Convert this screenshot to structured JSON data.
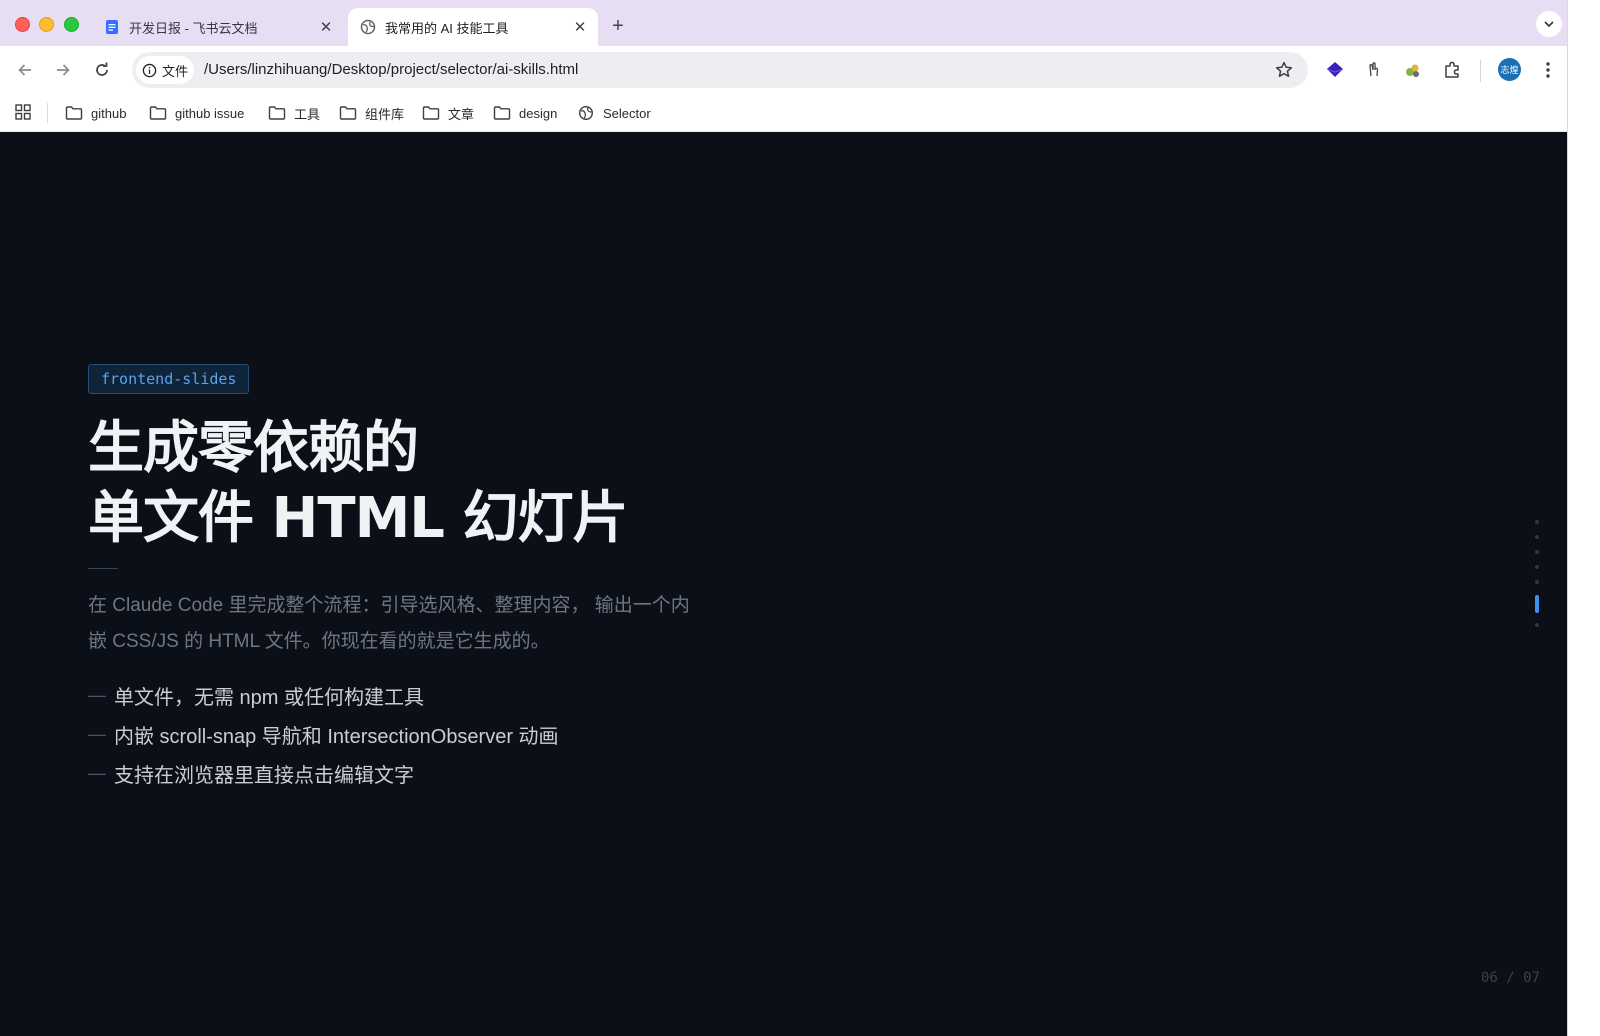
{
  "browser": {
    "tabs": [
      {
        "title": "开发日报 - 飞书云文档",
        "active": false,
        "favicon": "doc-icon"
      },
      {
        "title": "我常用的 AI 技能工具",
        "active": true,
        "favicon": "globe-icon"
      }
    ],
    "address": {
      "site_label": "文件",
      "url": "/Users/linzhihuang/Desktop/project/selector/ai-skills.html"
    },
    "avatar_text": "志煌",
    "bookmarks": [
      {
        "label": "github",
        "icon": "folder-icon"
      },
      {
        "label": "github issue",
        "icon": "folder-icon"
      },
      {
        "label": "工具",
        "icon": "folder-icon"
      },
      {
        "label": "组件库",
        "icon": "folder-icon"
      },
      {
        "label": "文章",
        "icon": "folder-icon"
      },
      {
        "label": "design",
        "icon": "folder-icon"
      },
      {
        "label": "Selector",
        "icon": "globe-icon"
      }
    ]
  },
  "slide": {
    "tag": "frontend-slides",
    "headline_line1": "生成零依赖的",
    "headline_line2": "单文件 HTML 幻灯片",
    "description": "在 Claude Code 里完成整个流程：引导选风格、整理内容， 输出一个内嵌 CSS/JS 的 HTML 文件。你现在看的就是它生成的。",
    "bullets": [
      "单文件，无需 npm 或任何构建工具",
      "内嵌 scroll-snap 导航和 IntersectionObserver 动画",
      "支持在浏览器里直接点击编辑文字"
    ],
    "bullet_marker": "—",
    "pager": "06 / 07",
    "current_slide": 6,
    "total_slides": 7
  },
  "colors": {
    "slide_bg": "#0b0f17",
    "accent": "#3d8ef0",
    "tab_strip": "#e7def3"
  }
}
